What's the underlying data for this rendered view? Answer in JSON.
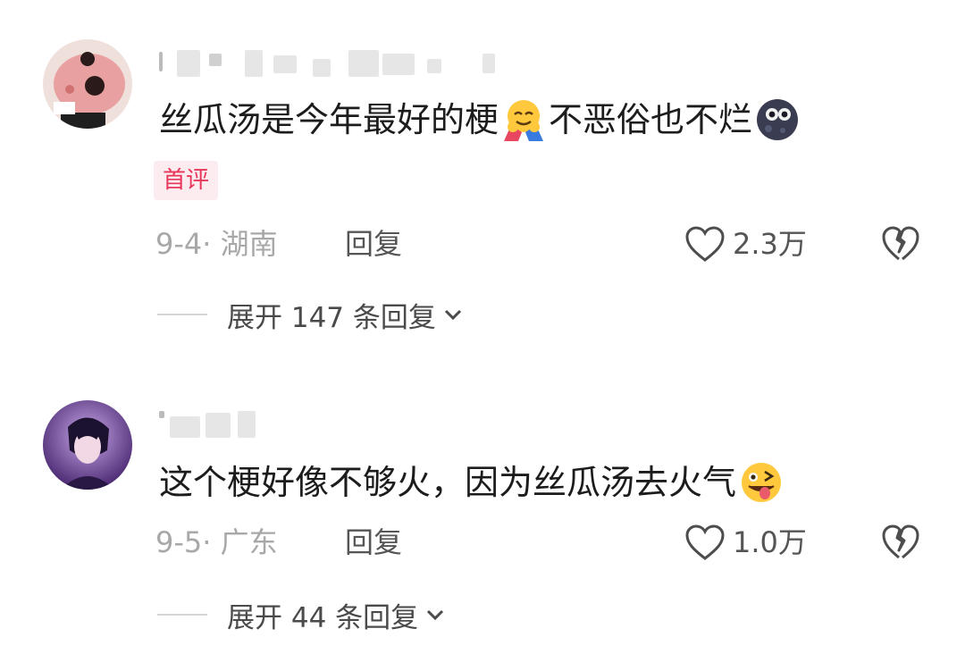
{
  "comments": [
    {
      "text_1": "丝瓜汤是今年最好的梗",
      "emoji_1": "hugging-face-emoji",
      "text_2": "不恶俗也不烂",
      "emoji_2": "new-moon-face-emoji",
      "badge": "首评",
      "date_location": "9-4· 湖南",
      "reply_label": "回复",
      "likes": "2.3万",
      "expand_label": "展开 147 条回复"
    },
    {
      "text_1": "这个梗好像不够火，因为丝瓜汤去火气",
      "emoji_1": "winking-tongue-face-emoji",
      "date_location": "9-5· 广东",
      "reply_label": "回复",
      "likes": "1.0万",
      "expand_label": "展开 44 条回复"
    }
  ],
  "colors": {
    "badge_text": "#e8355a",
    "badge_bg": "#fdecef",
    "meta_gray": "#a8a8a8",
    "action_gray": "#555555"
  }
}
